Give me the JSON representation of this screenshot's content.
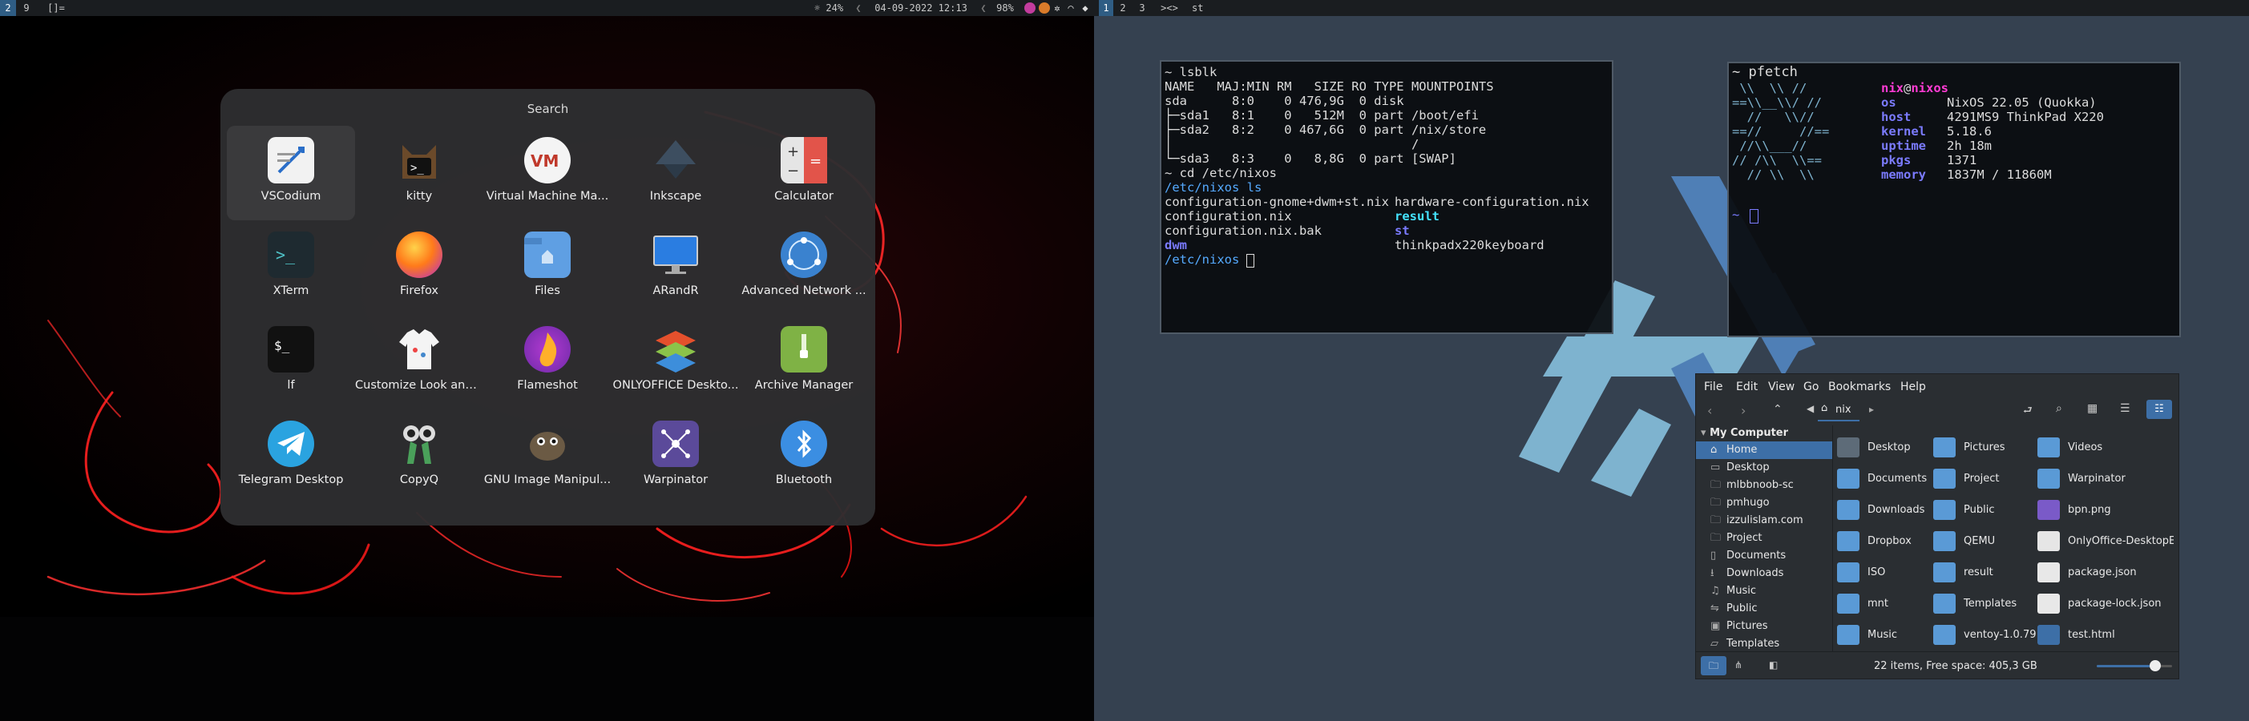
{
  "left_bar": {
    "tags": [
      "2",
      "9"
    ],
    "layout": "[]=",
    "status": [
      "☼ 24%",
      "04-09-2022 12:13",
      "98%"
    ]
  },
  "overview": {
    "search_label": "Search",
    "apps": [
      {
        "label": "VSCodium",
        "icon": "vscodium-icon"
      },
      {
        "label": "kitty",
        "icon": "kitty-icon"
      },
      {
        "label": "Virtual Machine Ma...",
        "icon": "virt-manager-icon"
      },
      {
        "label": "Inkscape",
        "icon": "inkscape-icon"
      },
      {
        "label": "Calculator",
        "icon": "calculator-icon"
      },
      {
        "label": "XTerm",
        "icon": "xterm-icon"
      },
      {
        "label": "Firefox",
        "icon": "firefox-icon"
      },
      {
        "label": "Files",
        "icon": "files-icon"
      },
      {
        "label": "ARandR",
        "icon": "arandr-icon"
      },
      {
        "label": "Advanced Network ...",
        "icon": "network-icon"
      },
      {
        "label": "lf",
        "icon": "lf-icon"
      },
      {
        "label": "Customize Look and...",
        "icon": "customize-icon"
      },
      {
        "label": "Flameshot",
        "icon": "flameshot-icon"
      },
      {
        "label": "ONLYOFFICE Deskto...",
        "icon": "onlyoffice-icon"
      },
      {
        "label": "Archive Manager",
        "icon": "archive-icon"
      },
      {
        "label": "Telegram Desktop",
        "icon": "telegram-icon"
      },
      {
        "label": "CopyQ",
        "icon": "copyq-icon"
      },
      {
        "label": "GNU Image Manipul...",
        "icon": "gimp-icon"
      },
      {
        "label": "Warpinator",
        "icon": "warpinator-icon"
      },
      {
        "label": "Bluetooth",
        "icon": "bluetooth-icon"
      }
    ]
  },
  "right_bar": {
    "tags": [
      "1",
      "2",
      "3"
    ],
    "layout": "><>",
    "title": "st"
  },
  "terminal_left": {
    "lines": [
      "~ lsblk",
      "NAME   MAJ:MIN RM   SIZE RO TYPE MOUNTPOINTS",
      "sda      8:0    0 476,9G  0 disk",
      "├─sda1   8:1    0   512M  0 part /boot/efi",
      "├─sda2   8:2    0 467,6G  0 part /nix/store",
      "│                                /",
      "└─sda3   8:3    0   8,8G  0 part [SWAP]",
      "~ cd /etc/nixos",
      "/etc/nixos ls"
    ],
    "ls_col1": [
      "configuration-gnome+dwm+st.nix",
      "configuration.nix",
      "configuration.nix.bak",
      "dwm"
    ],
    "ls_col2": [
      "hardware-configuration.nix",
      "result",
      "st",
      "thinkpadx220keyboard"
    ],
    "prompt": "/etc/nixos"
  },
  "terminal_right": {
    "command": "~ pfetch",
    "logo": [
      " \\\\  \\\\ //",
      "==\\\\__\\\\/ //",
      "  //   \\\\//",
      "==//     //==",
      " //\\\\___//",
      "// /\\\\  \\\\==",
      "  // \\\\  \\\\"
    ],
    "user": "nix",
    "at": "@",
    "host": "nixos",
    "fields": [
      {
        "key": "os",
        "value": "NixOS 22.05 (Quokka)"
      },
      {
        "key": "host",
        "value": "4291MS9 ThinkPad X220"
      },
      {
        "key": "kernel",
        "value": "5.18.6"
      },
      {
        "key": "uptime",
        "value": "2h 18m"
      },
      {
        "key": "pkgs",
        "value": "1371"
      },
      {
        "key": "memory",
        "value": "1837M / 11860M"
      }
    ],
    "prompt": "~"
  },
  "file_manager": {
    "menu": [
      "File",
      "Edit",
      "View",
      "Go",
      "Bookmarks",
      "Help"
    ],
    "location": "nix",
    "tree_header": "My Computer",
    "sidebar": [
      "Home",
      "Desktop",
      "mlbbnoob-sc",
      "pmhugo",
      "izzulislam.com",
      "Project",
      "Documents",
      "Downloads",
      "Music",
      "Public",
      "Pictures",
      "Templates"
    ],
    "files": [
      {
        "name": "Desktop",
        "icon": "folder-desktop-icon"
      },
      {
        "name": "Pictures",
        "icon": "folder-pictures-icon"
      },
      {
        "name": "Videos",
        "icon": "folder-videos-icon"
      },
      {
        "name": "Documents",
        "icon": "folder-documents-icon"
      },
      {
        "name": "Project",
        "icon": "folder-icon"
      },
      {
        "name": "Warpinator",
        "icon": "folder-icon"
      },
      {
        "name": "Downloads",
        "icon": "folder-downloads-icon"
      },
      {
        "name": "Public",
        "icon": "folder-public-icon"
      },
      {
        "name": "bpn.png",
        "icon": "image-file-icon"
      },
      {
        "name": "Dropbox",
        "icon": "folder-icon"
      },
      {
        "name": "QEMU",
        "icon": "folder-icon"
      },
      {
        "name": "OnlyOffice-DesktopEdito",
        "icon": "gear-file-icon"
      },
      {
        "name": "ISO",
        "icon": "folder-icon"
      },
      {
        "name": "result",
        "icon": "folder-link-icon"
      },
      {
        "name": "package.json",
        "icon": "json-file-icon"
      },
      {
        "name": "mnt",
        "icon": "folder-icon"
      },
      {
        "name": "Templates",
        "icon": "folder-templates-icon"
      },
      {
        "name": "package-lock.json",
        "icon": "json-file-icon"
      },
      {
        "name": "Music",
        "icon": "folder-music-icon"
      },
      {
        "name": "ventoy-1.0.79",
        "icon": "folder-icon"
      },
      {
        "name": "test.html",
        "icon": "html-file-icon"
      }
    ],
    "status": "22 items, Free space: 405,3 GB",
    "zoom": 0.78
  },
  "colors": {
    "bar_bg": "#1a1d20",
    "bar_active": "#2f5d84",
    "overview_bg": "#2e2e30",
    "desktop_right": "#354150",
    "fm_selection": "#3d6fa7",
    "nix_light": "#7eb3cf",
    "nix_dark": "#4f7fb6",
    "term_dir": "#55aaff",
    "term_cyan": "#44e3ff",
    "pfetch_magenta": "#ff3bd4",
    "pfetch_key": "#7b7bff"
  }
}
